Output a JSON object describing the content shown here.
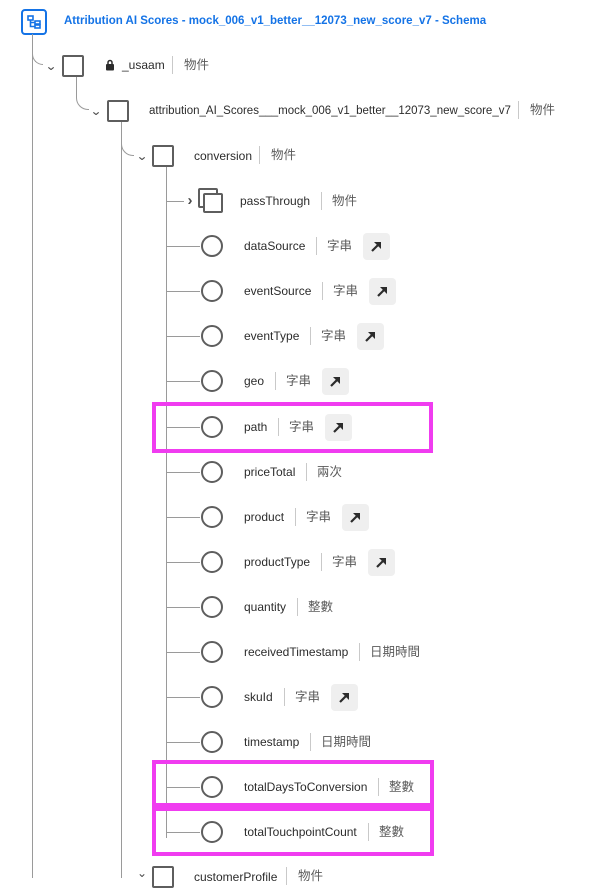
{
  "header": {
    "title": "Attribution AI Scores - mock_006_v1_better__12073_new_score_v7 - Schema",
    "icon": "schema-tree-icon"
  },
  "colors": {
    "accent": "#1473e6",
    "highlight": "#f03cf0",
    "node_stroke": "#5e5e5e",
    "tree_line": "#9a9a9a"
  },
  "tree": {
    "root_field": {
      "name": "_usaam",
      "type": "物件",
      "locked": true,
      "icon": "lock-icon"
    },
    "attribution_field": {
      "name": "attribution_AI_Scores___mock_006_v1_better__12073_new_score_v7",
      "type": "物件"
    },
    "conversion_field": {
      "name": "conversion",
      "type": "物件"
    },
    "conversion_children": [
      {
        "name": "passThrough",
        "type": "物件",
        "kind": "object"
      },
      {
        "name": "dataSource",
        "type": "字串",
        "kind": "leaf",
        "has_link": true
      },
      {
        "name": "eventSource",
        "type": "字串",
        "kind": "leaf",
        "has_link": true
      },
      {
        "name": "eventType",
        "type": "字串",
        "kind": "leaf",
        "has_link": true
      },
      {
        "name": "geo",
        "type": "字串",
        "kind": "leaf",
        "has_link": true
      },
      {
        "name": "path",
        "type": "字串",
        "kind": "leaf",
        "has_link": true,
        "highlighted": true
      },
      {
        "name": "priceTotal",
        "type": "兩次",
        "kind": "leaf",
        "has_link": false
      },
      {
        "name": "product",
        "type": "字串",
        "kind": "leaf",
        "has_link": true
      },
      {
        "name": "productType",
        "type": "字串",
        "kind": "leaf",
        "has_link": true
      },
      {
        "name": "quantity",
        "type": "整數",
        "kind": "leaf",
        "has_link": false
      },
      {
        "name": "receivedTimestamp",
        "type": "日期時間",
        "kind": "leaf",
        "has_link": false
      },
      {
        "name": "skuId",
        "type": "字串",
        "kind": "leaf",
        "has_link": true
      },
      {
        "name": "timestamp",
        "type": "日期時間",
        "kind": "leaf",
        "has_link": false
      },
      {
        "name": "totalDaysToConversion",
        "type": "整數",
        "kind": "leaf",
        "has_link": false,
        "highlighted": true
      },
      {
        "name": "totalTouchpointCount",
        "type": "整數",
        "kind": "leaf",
        "has_link": false,
        "highlighted": true
      }
    ],
    "next_sibling_field": {
      "name": "customerProfile",
      "type": "物件"
    }
  }
}
